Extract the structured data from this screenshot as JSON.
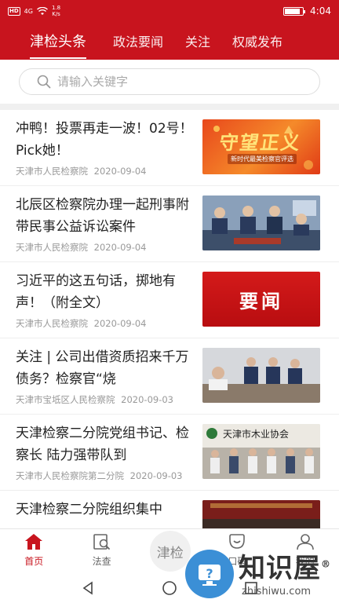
{
  "status_bar": {
    "chip": "HD",
    "network": "4G",
    "speed_value": "1.8",
    "speed_unit": "K/s",
    "time": "4:04",
    "battery_level": 0.85
  },
  "tabs": [
    {
      "label": "津检头条",
      "active": true
    },
    {
      "label": "政法要闻",
      "active": false
    },
    {
      "label": "关注",
      "active": false
    },
    {
      "label": "权威发布",
      "active": false
    }
  ],
  "search": {
    "placeholder": "请输入关键字"
  },
  "news": [
    {
      "title": "冲鸭！投票再走一波！02号！Pick她！",
      "source": "天津市人民检察院",
      "date": "2020-09-04",
      "thumb_text": "守望正义",
      "thumb_sub": "新时代最美检察官评选"
    },
    {
      "title": "北辰区检察院办理一起刑事附带民事公益诉讼案件",
      "source": "天津市人民检察院",
      "date": "2020-09-04",
      "thumb_text": "",
      "thumb_sub": ""
    },
    {
      "title": "习近平的这五句话，掷地有声！（附全文）",
      "source": "天津市人民检察院",
      "date": "2020-09-04",
      "thumb_text": "要闻",
      "thumb_sub": ""
    },
    {
      "title": "关注 | 公司出借资质招来千万债务？检察官“烧",
      "source": "天津市宝坻区人民检察院",
      "date": "2020-09-03",
      "thumb_text": "",
      "thumb_sub": ""
    },
    {
      "title": "天津检察二分院党组书记、检察长 陆力强带队到",
      "source": "天津市人民检察院第二分院",
      "date": "2020-09-03",
      "thumb_text": "天津市木业协会",
      "thumb_sub": ""
    },
    {
      "title": "天津检察二分院组织集中",
      "source": "",
      "date": "",
      "thumb_text": "",
      "thumb_sub": ""
    }
  ],
  "bottom_nav": [
    {
      "label": "首页",
      "icon": "home-icon",
      "active": true
    },
    {
      "label": "法查",
      "icon": "law-search-icon",
      "active": false
    },
    {
      "label": "津检",
      "icon": "center-logo",
      "active": false
    },
    {
      "label": "口碑",
      "icon": "comment-icon",
      "active": false
    },
    {
      "label": "我的",
      "icon": "person-icon",
      "active": false
    }
  ],
  "watermark": {
    "text": "知识屋",
    "url": "zhishiwu.com",
    "reg": "®"
  },
  "colors": {
    "brand_red": "#c8141e",
    "watermark_blue": "#3b8fd6"
  }
}
